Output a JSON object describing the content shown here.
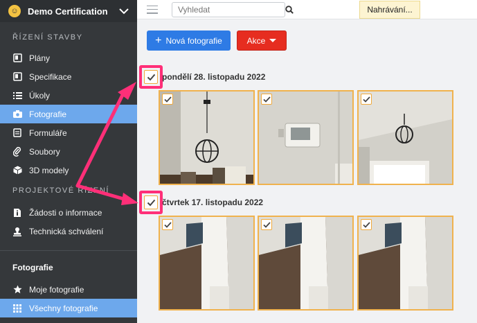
{
  "sidebar": {
    "project_name": "Demo Certification",
    "section_construction": "ŘÍZENÍ STAVBY",
    "items_construction": [
      {
        "label": "Plány",
        "icon": "book-icon"
      },
      {
        "label": "Specifikace",
        "icon": "book-icon"
      },
      {
        "label": "Úkoly",
        "icon": "list-icon"
      },
      {
        "label": "Fotografie",
        "icon": "camera-icon"
      },
      {
        "label": "Formuláře",
        "icon": "form-icon"
      },
      {
        "label": "Soubory",
        "icon": "paperclip-icon"
      },
      {
        "label": "3D modely",
        "icon": "cube-icon"
      }
    ],
    "section_project": "PROJEKTOVÉ ŘÍZENÍ",
    "items_project": [
      {
        "label": "Žádosti o informace",
        "icon": "info-icon"
      },
      {
        "label": "Technická schválení",
        "icon": "stamp-icon"
      }
    ],
    "section_photos": "Fotografie",
    "items_photos": [
      {
        "label": "Moje fotografie",
        "icon": "star-icon"
      },
      {
        "label": "Všechny fotografie",
        "icon": "grid-icon"
      }
    ]
  },
  "topbar": {
    "search_placeholder": "Vyhledat",
    "uploading_label": "Nahrávání..."
  },
  "toolbar": {
    "new_photo_label": "Nová fotografie",
    "action_label": "Akce"
  },
  "groups": [
    {
      "date": "pondělí 28. listopadu 2022",
      "photo_count": 3
    },
    {
      "date": "čtvrtek 17. listopadu 2022",
      "photo_count": 3
    }
  ],
  "colors": {
    "accent_blue": "#2e7be5",
    "action_red": "#e62d20",
    "selection_orange": "#f0b24d",
    "annotation_pink": "#ff2f78",
    "sidebar_bg": "#35383b",
    "sidebar_active": "#6da8ec"
  }
}
